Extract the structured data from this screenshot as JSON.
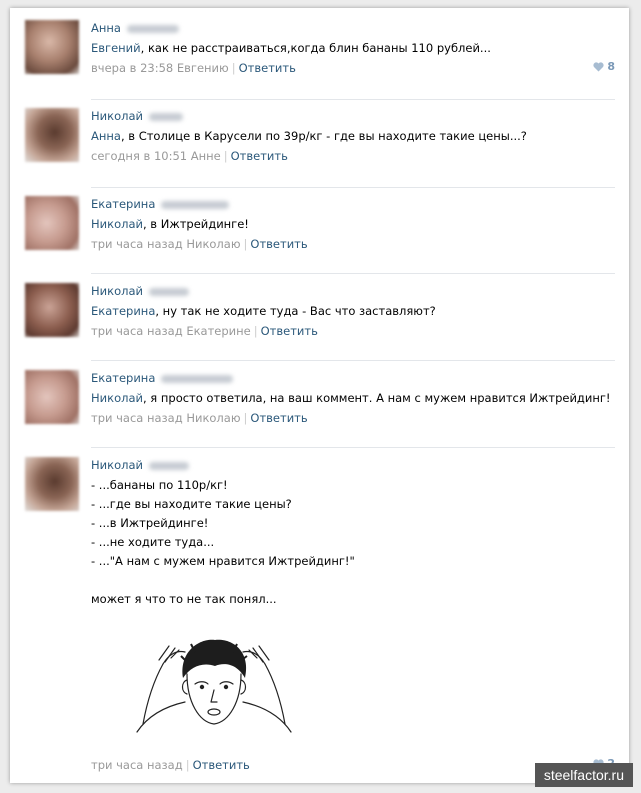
{
  "comments": [
    {
      "author": "Анна",
      "lines": [
        {
          "addr": "Евгений",
          "rest": ", как не расстраиваться,когда блин бананы 110 рублей..."
        }
      ],
      "time": "вчера в 23:58 Евгению",
      "reply": "Ответить",
      "likes": "8"
    },
    {
      "author": "Николай",
      "lines": [
        {
          "addr": "Анна",
          "rest": ", в Столице в Карусели по 39р/кг - где вы находите такие цены...?"
        }
      ],
      "time": "сегодня в 10:51 Анне",
      "reply": "Ответить"
    },
    {
      "author": "Екатерина",
      "lines": [
        {
          "addr": "Николай",
          "rest": ", в Ижтрейдинге!"
        }
      ],
      "time": "три часа назад Николаю",
      "reply": "Ответить"
    },
    {
      "author": "Николай",
      "lines": [
        {
          "addr": "Екатерина",
          "rest": ", ну так не ходите туда - Вас что заставляют?"
        }
      ],
      "time": "три часа назад Екатерине",
      "reply": "Ответить"
    },
    {
      "author": "Екатерина",
      "lines": [
        {
          "addr": "Николай",
          "rest": ", я просто ответила, на ваш коммент. А нам с мужем нравится Ижтрейдинг!"
        }
      ],
      "time": "три часа назад Николаю",
      "reply": "Ответить"
    },
    {
      "author": "Николай",
      "lines": [
        "- ...бананы по 110р/кг!",
        "- ...где вы находите такие цены?",
        "- ...в Ижтрейдинге!",
        "- ...не ходите туда...",
        "- ...\"А нам с мужем нравится Ижтрейдинг!\"",
        "",
        "может я что то не так понял..."
      ],
      "time": "три часа назад",
      "reply": "Ответить",
      "likes": "2"
    }
  ],
  "watermark": "steelfactor.ru",
  "colors": {
    "link": "#2b587a",
    "meta": "#999999",
    "like": "#7b99b7"
  },
  "icons": {
    "like": "heart-icon",
    "meme": "confused-face-meme"
  }
}
